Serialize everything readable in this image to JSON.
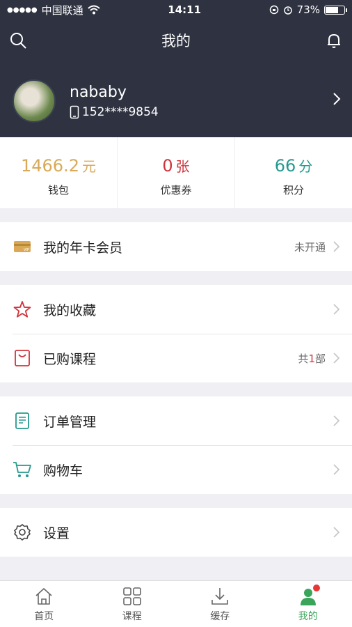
{
  "status_bar": {
    "carrier": "中国联通",
    "time": "14:11",
    "battery": "73%",
    "battery_level": 0.73
  },
  "header": {
    "title": "我的",
    "left_icon": "search-icon",
    "right_icon": "bell-icon"
  },
  "profile": {
    "name": "nababy",
    "phone": "152****9854"
  },
  "stats": [
    {
      "value": "1466.2",
      "unit": "元",
      "label": "钱包",
      "color": "#d9a957"
    },
    {
      "value": "0",
      "unit": "张",
      "label": "优惠券",
      "color": "#d0343b"
    },
    {
      "value": "66",
      "unit": "分",
      "label": "积分",
      "color": "#249a8f"
    }
  ],
  "menu": {
    "vip": {
      "label": "我的年卡会员",
      "status": "未开通",
      "icon": "vip-card-icon"
    },
    "favorites": {
      "label": "我的收藏",
      "icon": "star-icon"
    },
    "purchased": {
      "label": "已购课程",
      "prefix": "共",
      "count": "1",
      "suffix": "部",
      "icon": "bag-icon"
    },
    "orders": {
      "label": "订单管理",
      "icon": "document-icon"
    },
    "cart": {
      "label": "购物车",
      "icon": "cart-icon"
    },
    "settings": {
      "label": "设置",
      "icon": "gear-icon"
    }
  },
  "tabbar": [
    {
      "label": "首页",
      "icon": "home-icon"
    },
    {
      "label": "课程",
      "icon": "grid-icon"
    },
    {
      "label": "缓存",
      "icon": "download-icon"
    },
    {
      "label": "我的",
      "icon": "user-icon",
      "active": true
    }
  ],
  "colors": {
    "header_bg": "#2f3341",
    "accent_red": "#d0343b",
    "accent_teal": "#249a8f",
    "accent_gold": "#d9a957",
    "active_tab": "#3aa55a"
  }
}
